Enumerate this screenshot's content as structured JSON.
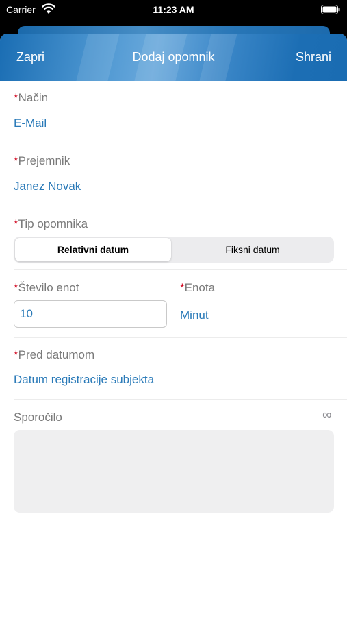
{
  "status_bar": {
    "carrier": "Carrier",
    "time": "11:23 AM"
  },
  "navbar": {
    "close_label": "Zapri",
    "title": "Dodaj opomnik",
    "save_label": "Shrani"
  },
  "fields": {
    "required_mark": "*",
    "method": {
      "label": "Način",
      "value": "E-Mail"
    },
    "recipient": {
      "label": "Prejemnik",
      "value": "Janez Novak"
    },
    "reminder_type": {
      "label": "Tip opomnika",
      "options": [
        "Relativni datum",
        "Fiksni datum"
      ],
      "selected": "Relativni datum"
    },
    "unit_count": {
      "label": "Število enot",
      "value": "10"
    },
    "unit": {
      "label": "Enota",
      "value": "Minut"
    },
    "before_date": {
      "label": "Pred datumom",
      "value": "Datum registracije subjekta"
    },
    "message": {
      "label": "Sporočilo",
      "icon": "infinity-icon",
      "value": ""
    }
  },
  "colors": {
    "accent": "#2a7ab8",
    "required": "#d0021b",
    "navbar": "#1a6db3"
  }
}
